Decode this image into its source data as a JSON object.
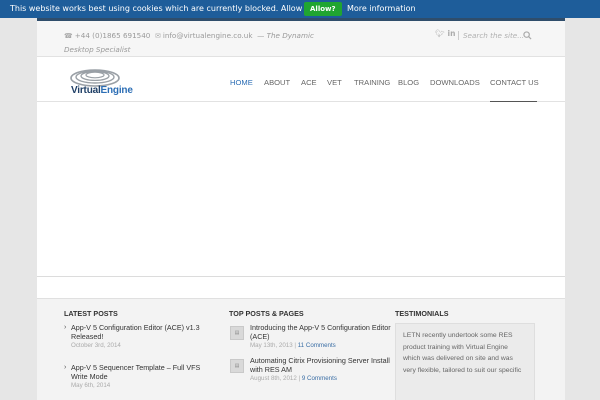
{
  "cookie": {
    "message": "This website works best using cookies which are currently blocked. Allow cookies?",
    "allow_label": "Allow?",
    "more_label": "More information"
  },
  "topbar": {
    "phone": "+44 (0)1865 691540",
    "email": "info@virtualengine.co.uk",
    "tagline": "— The Dynamic Desktop Specialist",
    "search_placeholder": "Search the site..."
  },
  "logo": {
    "part1": "Virtual",
    "part2": "Engine"
  },
  "nav": {
    "items": [
      "HOME",
      "ABOUT",
      "ACE",
      "VET",
      "TRAINING",
      "BLOG",
      "DOWNLOADS",
      "CONTACT US"
    ],
    "active": "HOME"
  },
  "footer": {
    "latest_title": "LATEST POSTS",
    "latest": [
      {
        "title": "App-V 5 Configuration Editor (ACE) v1.3 Released!",
        "date": "October 3rd, 2014"
      },
      {
        "title": "App-V 5 Sequencer Template – Full VFS Write Mode",
        "date": "May 6th, 2014"
      }
    ],
    "top_title": "TOP POSTS & PAGES",
    "top": [
      {
        "title": "Introducing the App-V 5 Configuration Editor (ACE)",
        "date": "May 13th, 2013",
        "comments": "11 Comments"
      },
      {
        "title": "Automating Citrix Provisioning Server Install with RES AM",
        "date": "August 8th, 2012",
        "comments": "9 Comments"
      }
    ],
    "testimonials_title": "TESTIMONIALS",
    "testimonial_text": "LETN recently undertook some RES product training with Virtual Engine which was delivered on site and was very flexible, tailored to suit our specific"
  },
  "colors": {
    "cookie_bar": "#1e5d9a",
    "allow_button": "#20a531",
    "accent": "#2c6eb5",
    "dark_accent": "#2f4d6b"
  }
}
